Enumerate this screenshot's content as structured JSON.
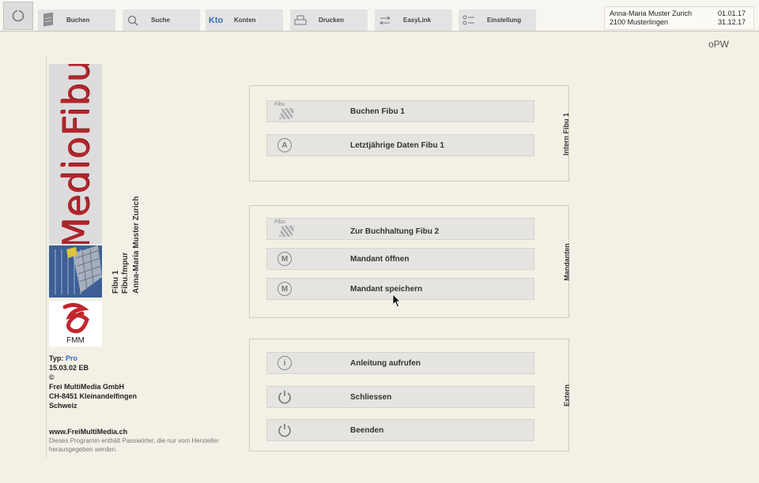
{
  "toolbar": {
    "items": [
      {
        "label": "Buchen",
        "icon": "ledger-icon"
      },
      {
        "label": "Suche",
        "icon": "search-icon"
      },
      {
        "label": "Konten",
        "icon_text": "Kto"
      },
      {
        "label": "Drucken",
        "icon": "printer-icon"
      },
      {
        "label": "EasyLink",
        "icon": "transfer-icon"
      },
      {
        "label": "Einstellung",
        "icon": "settings-list-icon"
      }
    ]
  },
  "user": {
    "name": "Anna-Maria Muster Zurich",
    "address": "2100 Musterlingen",
    "date_from": "01.01.17",
    "date_to": "31.12.17"
  },
  "opw": "oPW",
  "sidebar": {
    "logo_text": "MedioFibu",
    "fmm_text": "FMM",
    "fibu": "Fibu 1",
    "file": "Fibu.fmpur",
    "owner": "Anna-Maria Muster Zurich",
    "typ_label": "Typ:",
    "typ_value": "Pro",
    "version": "15.03.02 EB",
    "copyright": "©",
    "company": "Frei MultiMedia GmbH",
    "street": "CH-8451 Kleinandelfingen",
    "country": "Schweiz",
    "website": "www.FreiMultiMedia.ch",
    "note": "Dieses Programm enthält Passwörter, die nur vom Hersteller herausgegeben werden."
  },
  "groups": {
    "intern": {
      "title": "Intern Fibu 1",
      "buttons": [
        {
          "label": "Buchen  Fibu 1",
          "icon": "fibu"
        },
        {
          "label": "Letztjährige Daten  Fibu 1",
          "icon": "A"
        }
      ]
    },
    "mandanten": {
      "title": "Mandanten",
      "buttons": [
        {
          "label": "Zur Buchhaltung  Fibu 2",
          "icon": "fibu"
        },
        {
          "label": "Mandant öffnen",
          "icon": "M"
        },
        {
          "label": "Mandant speichern",
          "icon": "M"
        }
      ]
    },
    "extern": {
      "title": "Extern",
      "buttons": [
        {
          "label": "Anleitung aufrufen",
          "icon": "i"
        },
        {
          "label": "Schliessen",
          "icon": "power"
        },
        {
          "label": "Beenden",
          "icon": "power"
        }
      ]
    }
  },
  "fibu_icon_text": "Fibu"
}
